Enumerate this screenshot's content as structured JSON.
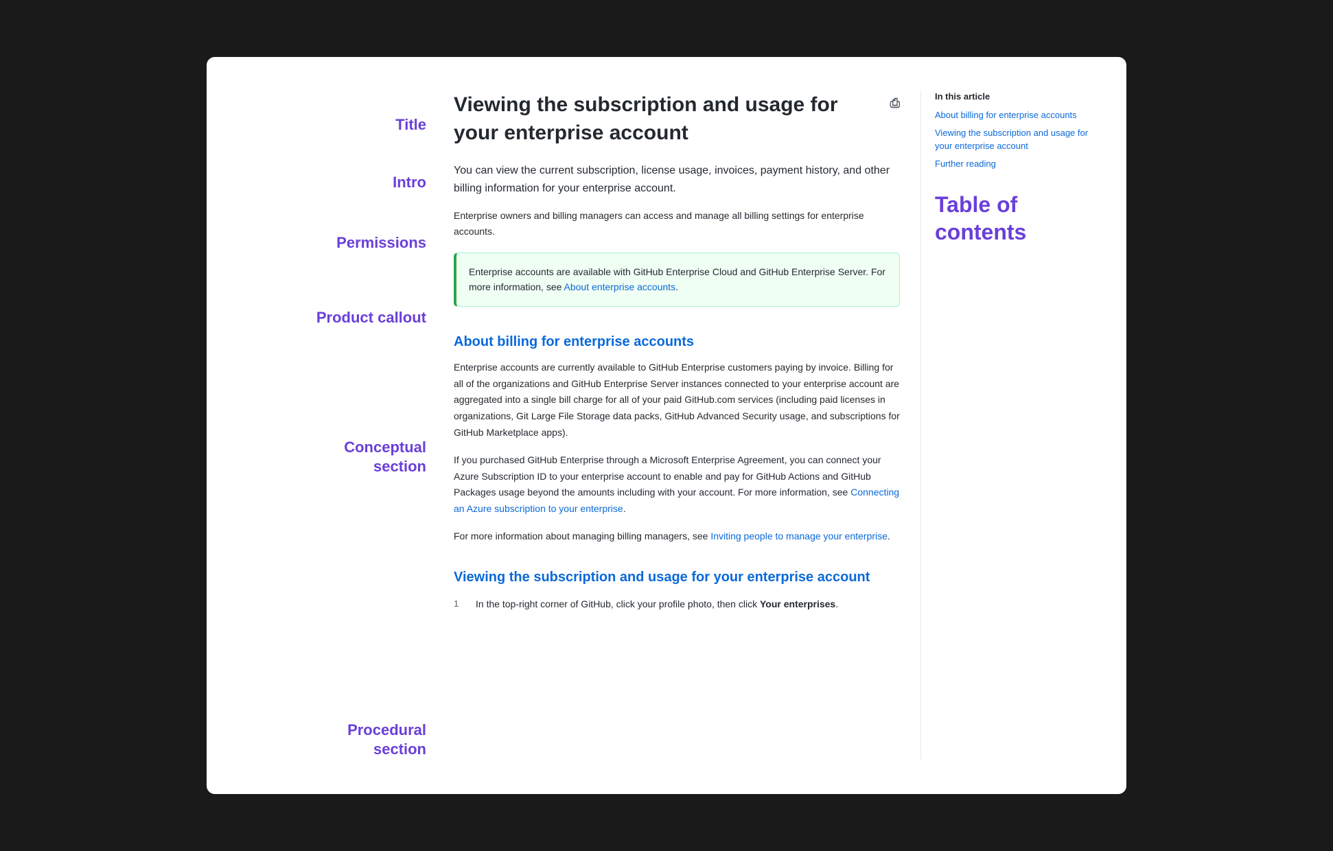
{
  "annotations": {
    "title_label": "Title",
    "intro_label": "Intro",
    "permissions_label": "Permissions",
    "product_callout_label": "Product callout",
    "conceptual_label_line1": "Conceptual",
    "conceptual_label_line2": "section",
    "procedural_label_line1": "Procedural",
    "procedural_label_line2": "section"
  },
  "article": {
    "title": "Viewing the subscription and usage for your enterprise account",
    "print_icon": "⎙",
    "intro": "You can view the current subscription, license usage, invoices, payment history, and other billing information for your enterprise account.",
    "permissions": "Enterprise owners and billing managers can access and manage all billing settings for enterprise accounts.",
    "callout_text": "Enterprise accounts are available with GitHub Enterprise Cloud and GitHub Enterprise Server. For more information, see ",
    "callout_link_text": "About enterprise accounts",
    "callout_link_suffix": ".",
    "conceptual_heading": "About billing for enterprise accounts",
    "conceptual_para1": "Enterprise accounts are currently available to GitHub Enterprise customers paying by invoice. Billing for all of the organizations and GitHub Enterprise Server instances connected to your enterprise account are aggregated into a single bill charge for all of your paid GitHub.com services (including paid licenses in organizations, Git Large File Storage data packs, GitHub Advanced Security usage, and subscriptions for GitHub Marketplace apps).",
    "conceptual_para2_prefix": "If you purchased GitHub Enterprise through a Microsoft Enterprise Agreement, you can connect your Azure Subscription ID to your enterprise account to enable and pay for GitHub Actions and GitHub Packages usage beyond the amounts including with your account. For more information, see ",
    "conceptual_para2_link_text": "Connecting an Azure subscription to your enterprise",
    "conceptual_para2_suffix": ".",
    "conceptual_para3_prefix": "For more information about managing billing managers, see ",
    "conceptual_para3_link_text": "Inviting people to manage your enterprise",
    "conceptual_para3_suffix": ".",
    "procedural_heading": "Viewing the subscription and usage for your enterprise account",
    "step1_prefix": "In the top-right corner of GitHub, click your profile photo, then click ",
    "step1_bold": "Your enterprises",
    "step1_suffix": "."
  },
  "toc": {
    "in_article_label": "In this article",
    "title_label_line1": "Table of",
    "title_label_line2": "contents",
    "links": [
      "About billing for enterprise accounts",
      "Viewing the subscription and usage for your enterprise account",
      "Further reading"
    ]
  }
}
